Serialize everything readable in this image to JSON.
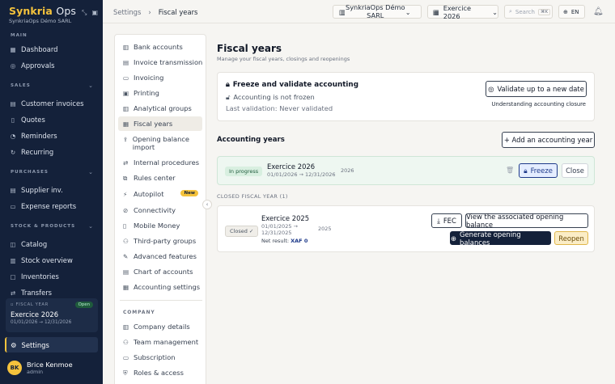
{
  "brand": {
    "name_a": "Synkria",
    "name_b": "Ops",
    "company": "SynkriaOps Démo SARL"
  },
  "sidebar": {
    "main_label": "MAIN",
    "sales_label": "SALES",
    "purchases_label": "PURCHASES",
    "stock_label": "STOCK & PRODUCTS",
    "items": {
      "dashboard": "Dashboard",
      "approvals": "Approvals",
      "customer_invoices": "Customer invoices",
      "quotes": "Quotes",
      "reminders": "Reminders",
      "recurring": "Recurring",
      "supplier_inv": "Supplier inv.",
      "expense_reports": "Expense reports",
      "catalog": "Catalog",
      "stock_overview": "Stock overview",
      "inventories": "Inventories",
      "transfers": "Transfers"
    },
    "fiscal_card": {
      "label": "FISCAL YEAR",
      "status": "Open",
      "name": "Exercice 2026",
      "dates": "01/01/2026 → 12/31/2026"
    },
    "settings": "Settings",
    "user": {
      "initials": "BK",
      "name": "Brice Kenmoe",
      "role": "admin"
    }
  },
  "topbar": {
    "crumb_root": "Settings",
    "crumb_sep": "›",
    "crumb_current": "Fiscal years",
    "company": "SynkriaOps Démo SARL",
    "year": "Exercice 2026",
    "search_placeholder": "Search",
    "search_kbd": "⌘K",
    "lang": "EN"
  },
  "settings_menu": {
    "items": [
      "Bank accounts",
      "Invoice transmission",
      "Invoicing",
      "Printing",
      "Analytical groups",
      "Fiscal years",
      "Opening balance import",
      "Internal procedures",
      "Rules center",
      "Autopilot",
      "Connectivity",
      "Mobile Money",
      "Third-party groups",
      "Advanced features",
      "Chart of accounts",
      "Accounting settings"
    ],
    "new_badge": "New",
    "company_label": "COMPANY",
    "company_items": [
      "Company details",
      "Team management",
      "Subscription",
      "Roles & access"
    ]
  },
  "page": {
    "title": "Fiscal years",
    "subtitle": "Manage your fiscal years, closings and reopenings"
  },
  "freeze": {
    "title": "Freeze and validate accounting",
    "status": "Accounting is not frozen",
    "last": "Last validation: Never validated",
    "validate_btn": "Validate up to a new date",
    "link": "Understanding accounting closure"
  },
  "years": {
    "title": "Accounting years",
    "add_btn": "+ Add an accounting year",
    "current": {
      "status": "In progress",
      "name": "Exercice 2026",
      "dates": "01/01/2026 → 12/31/2026",
      "code": "2026",
      "freeze_btn": "Freeze",
      "close_btn": "Close"
    },
    "closed_label": "CLOSED FISCAL YEAR (1)",
    "closed": {
      "status": "Closed ✓",
      "name": "Exercice 2025",
      "dates_a": "01/01/2025 →",
      "dates_b": "12/31/2025",
      "code": "2025",
      "net_label": "Net result:",
      "net_value": "XAF 0",
      "fec_btn": "FEC",
      "view_btn": "View the associated opening balance",
      "gen_btn": "Generate opening balances",
      "reopen_btn": "Reopen"
    }
  }
}
